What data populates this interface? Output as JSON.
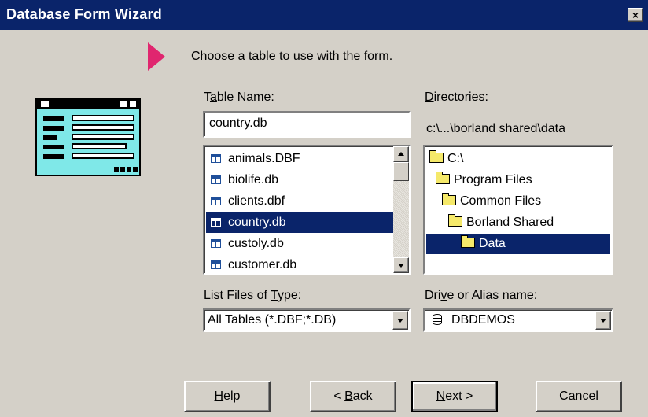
{
  "window": {
    "title": "Database Form Wizard",
    "close_label": "×"
  },
  "intro": {
    "text": "Choose a table to use with the form."
  },
  "table_name": {
    "label_pre": "T",
    "label_u": "a",
    "label_post": "ble Name:",
    "value": "country.db",
    "files": [
      "animals.DBF",
      "biolife.db",
      "clients.dbf",
      "country.db",
      "custoly.db",
      "customer.db"
    ],
    "selected": "country.db"
  },
  "directories": {
    "label_u": "D",
    "label_post": "irectories:",
    "path": "c:\\...\\borland shared\\data",
    "items": [
      "C:\\",
      "Program Files",
      "Common Files",
      "Borland Shared",
      "Data"
    ],
    "selected": "Data"
  },
  "file_type": {
    "label_pre": "List Files of ",
    "label_u": "T",
    "label_post": "ype:",
    "value": "All Tables (*.DBF;*.DB)"
  },
  "drive": {
    "label_pre": "Dri",
    "label_u": "v",
    "label_post": "e or Alias name:",
    "value": "DBDEMOS"
  },
  "buttons": {
    "help_u": "H",
    "help_post": "elp",
    "back_pre": "< ",
    "back_u": "B",
    "back_post": "ack",
    "next_u": "N",
    "next_post": "ext >",
    "cancel": "Cancel"
  }
}
